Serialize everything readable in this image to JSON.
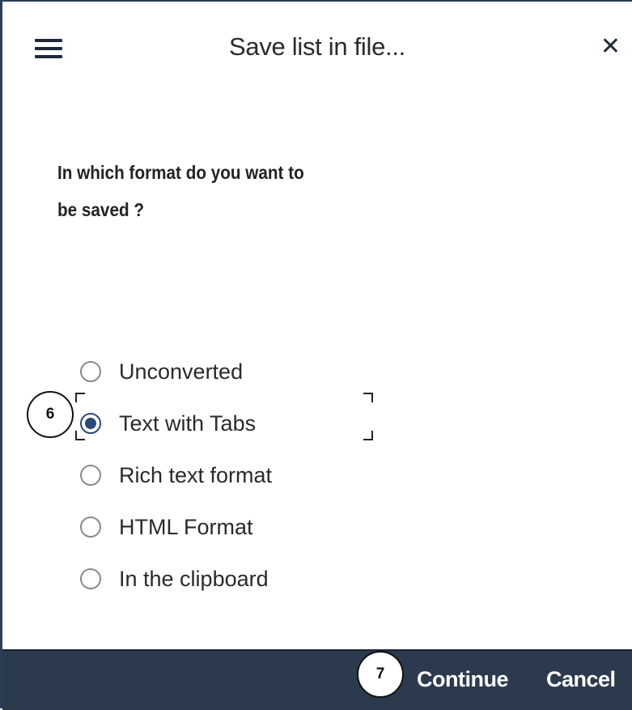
{
  "dialog": {
    "title": "Save list in file...",
    "close_glyph": "✕",
    "menu_icon": "hamburger-menu-icon",
    "question_line1": "In which format do you want to",
    "question_line2": "be saved ?"
  },
  "format_options": [
    {
      "label": "Unconverted",
      "selected": false
    },
    {
      "label": "Text with Tabs",
      "selected": true
    },
    {
      "label": "Rich text format",
      "selected": false
    },
    {
      "label": "HTML Format",
      "selected": false
    },
    {
      "label": "In the clipboard",
      "selected": false
    }
  ],
  "callouts": {
    "step_6": "6",
    "step_7": "7"
  },
  "footer": {
    "continue_label": "Continue",
    "cancel_label": "Cancel"
  },
  "colors": {
    "footer_bg": "#2c3a4e",
    "radio_selected": "#2a4a78",
    "footer_text": "#ffffff"
  }
}
